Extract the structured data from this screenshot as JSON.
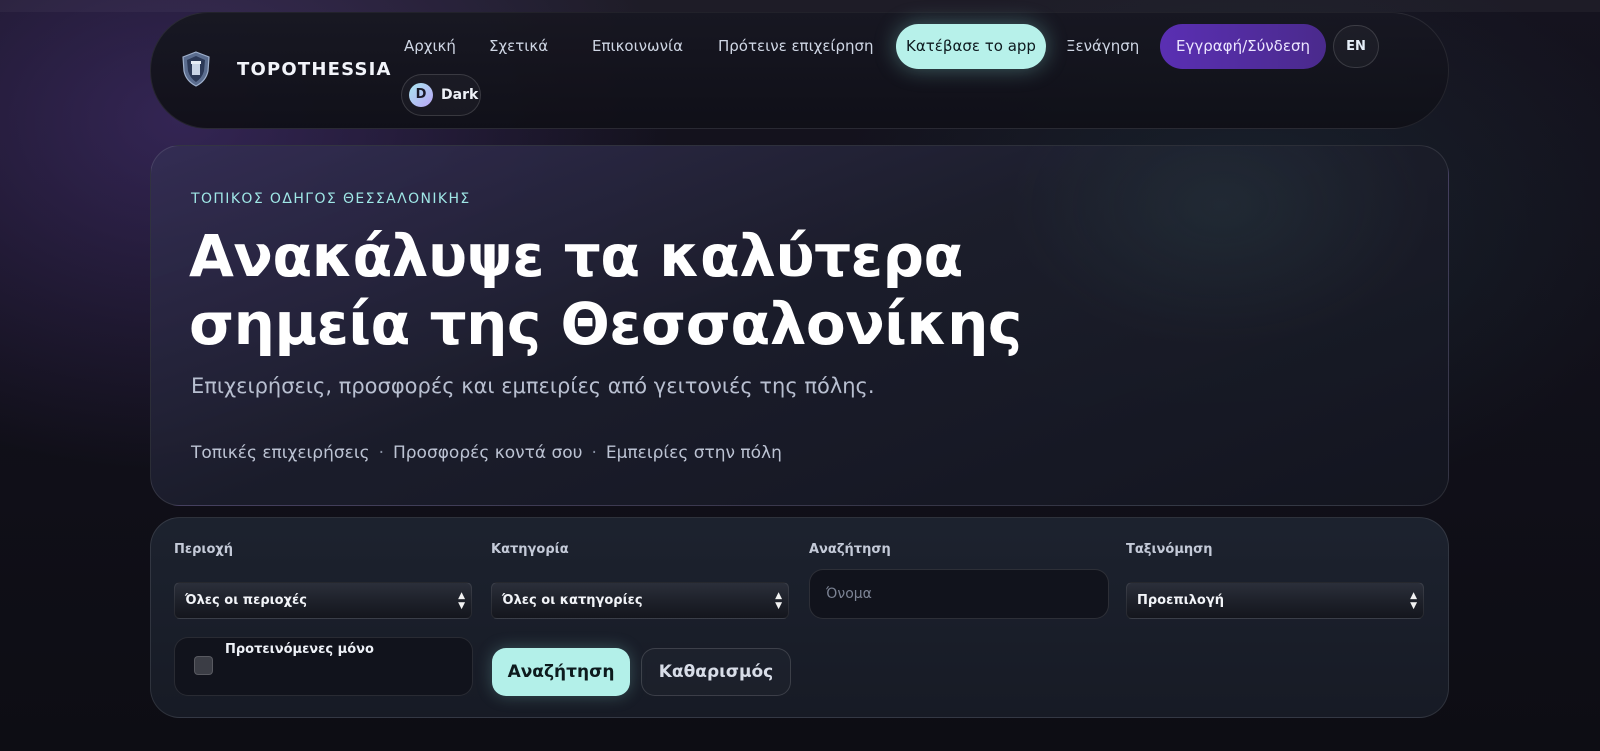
{
  "header": {
    "brand": "TOPOTHESSIA",
    "nav": [
      {
        "label": "Αρχική"
      },
      {
        "label": "Σχετικά"
      },
      {
        "label": "Επικοινωνία"
      },
      {
        "label": "Πρότεινε επιχείρηση"
      }
    ],
    "download_app": "Κατέβασε το app",
    "tour": "Ξενάγηση",
    "auth": "Εγγραφή/Σύνδεση",
    "lang": "EN",
    "theme_initial": "D",
    "theme_label": "Dark"
  },
  "hero": {
    "eyebrow": "ΤΟΠΙΚΟΣ ΟΔΗΓΟΣ ΘΕΣΣΑΛΟΝΙΚΗΣ",
    "title_line1": "Ανακάλυψε τα καλύτερα",
    "title_line2": "σημεία της Θεσσαλονίκης",
    "subtitle": "Επιχειρήσεις, προσφορές και εμπειρίες από γειτονιές της πόλης.",
    "tags": [
      "Τοπικές επιχειρήσεις",
      "Προσφορές κοντά σου",
      "Εμπειρίες στην πόλη"
    ],
    "tag_separator": "·"
  },
  "filters": {
    "area_label": "Περιοχή",
    "area_value": "Όλες οι περιοχές",
    "category_label": "Κατηγορία",
    "category_value": "Όλες οι κατηγορίες",
    "search_label": "Αναζήτηση",
    "search_placeholder": "Όνομα",
    "sort_label": "Ταξινόμηση",
    "sort_value": "Προεπιλογή",
    "featured_only": "Προτεινόμενες μόνο",
    "search_button": "Αναζήτηση",
    "clear_button": "Καθαρισμός"
  },
  "colors": {
    "accent_mint": "#b3f0e9",
    "accent_purple": "#5a2fb3",
    "eyebrow": "#9fe7e6",
    "background": "#0d0d14"
  },
  "icons": {
    "logo": "shield-crest-icon",
    "select_arrows": "up-down-chevron-icon"
  }
}
